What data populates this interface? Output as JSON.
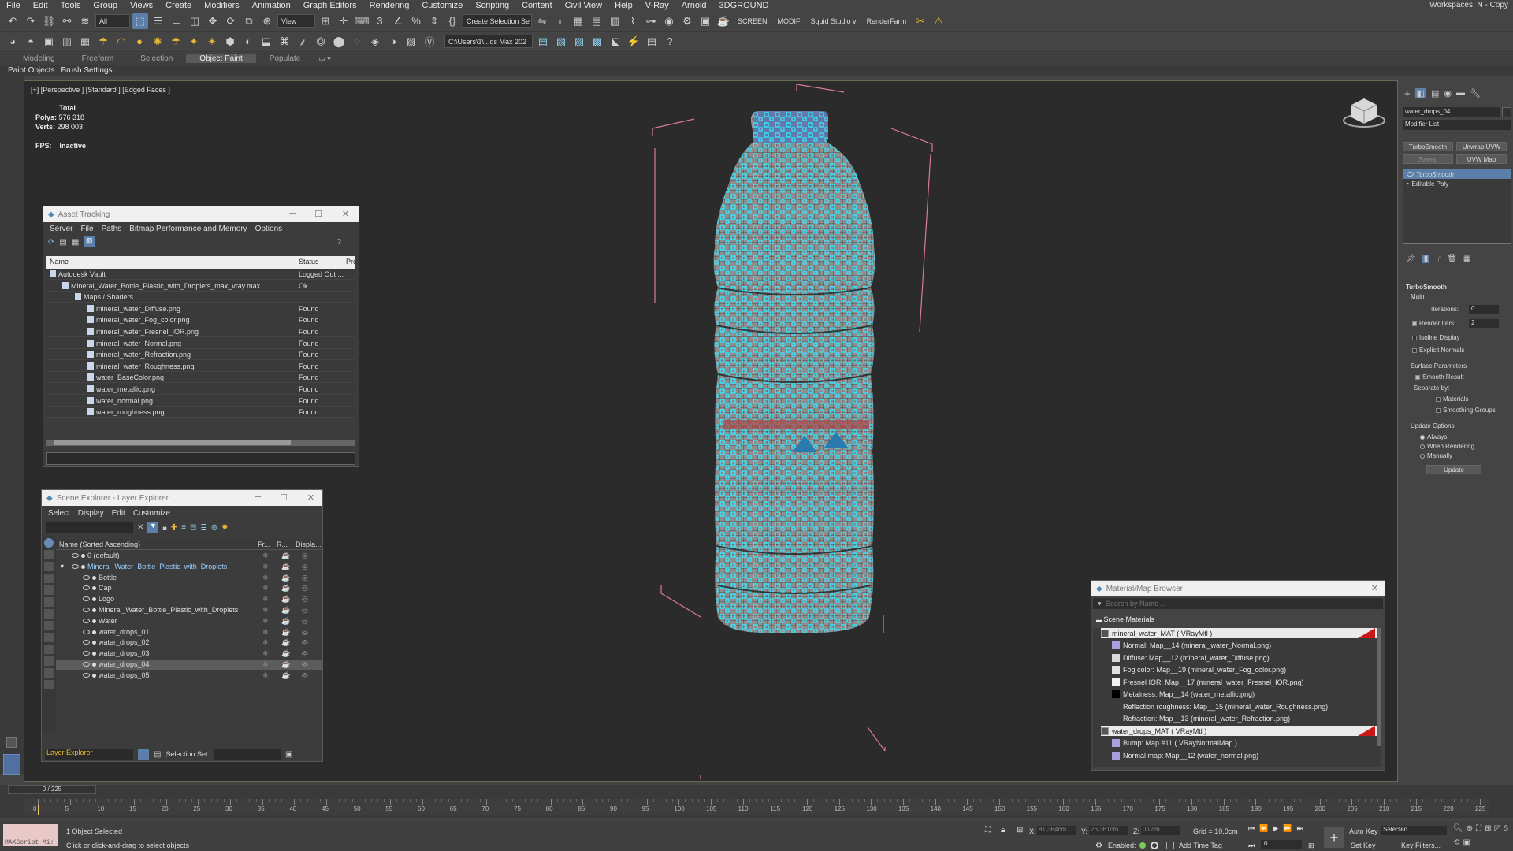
{
  "menubar": {
    "items": [
      "File",
      "Edit",
      "Tools",
      "Group",
      "Views",
      "Create",
      "Modifiers",
      "Animation",
      "Graph Editors",
      "Rendering",
      "Customize",
      "Scripting",
      "Content",
      "Civil View",
      "Help",
      "V-Ray",
      "Arnold",
      "3DGROUND"
    ],
    "workspace": "Workspaces:  N - Copy"
  },
  "toolbar1": {
    "selection_filter": "All",
    "ref_coord": "View",
    "named_selection": "Create Selection Se",
    "screen_label": "SCREEN",
    "modif_label": "MODIF",
    "studio_label": "Squid Studio v",
    "renderfarm_label": "RenderFarm"
  },
  "toolbar2": {
    "project_path": "C:\\Users\\1\\...ds Max 202"
  },
  "ribbon": {
    "tabs": [
      "Modeling",
      "Freeform",
      "Selection",
      "Object Paint",
      "Populate"
    ],
    "active": "Object Paint",
    "sub_items": [
      "Paint Objects",
      "Brush Settings"
    ]
  },
  "viewport": {
    "label": "[+] [Perspective ] [Standard ] [Edged Faces ]",
    "stats": {
      "total_label": "Total",
      "polys_label": "Polys:",
      "polys_value": "576 318",
      "verts_label": "Verts:",
      "verts_value": "298 003",
      "fps_label": "FPS:",
      "fps_value": "Inactive"
    }
  },
  "asset_tracking": {
    "title": "Asset Tracking",
    "menus": [
      "Server",
      "File",
      "Paths",
      "Bitmap Performance and Memory",
      "Options"
    ],
    "columns": [
      "Name",
      "Status",
      "Pro"
    ],
    "rows": [
      {
        "name": "Autodesk Vault",
        "status": "Logged Out ..."
      },
      {
        "name": "Mineral_Water_Bottle_Plastic_with_Droplets_max_vray.max",
        "status": "Ok"
      },
      {
        "name": "Maps / Shaders",
        "status": ""
      },
      {
        "name": "mineral_water_Diffuse.png",
        "status": "Found"
      },
      {
        "name": "mineral_water_Fog_color.png",
        "status": "Found"
      },
      {
        "name": "mineral_water_Fresnel_IOR.png",
        "status": "Found"
      },
      {
        "name": "mineral_water_Normal.png",
        "status": "Found"
      },
      {
        "name": "mineral_water_Refraction.png",
        "status": "Found"
      },
      {
        "name": "mineral_water_Roughness.png",
        "status": "Found"
      },
      {
        "name": "water_BaseColor.png",
        "status": "Found"
      },
      {
        "name": "water_metallic.png",
        "status": "Found"
      },
      {
        "name": "water_normal.png",
        "status": "Found"
      },
      {
        "name": "water_roughness.png",
        "status": "Found"
      }
    ]
  },
  "scene_explorer": {
    "title": "Scene Explorer - Layer Explorer",
    "menus": [
      "Select",
      "Display",
      "Edit",
      "Customize"
    ],
    "columns": [
      "Name (Sorted Ascending)",
      "Fr...",
      "R...",
      "Displa..."
    ],
    "rows": [
      {
        "name": "0 (default)",
        "selected": false
      },
      {
        "name": "Mineral_Water_Bottle_Plastic_with_Droplets",
        "selected": false
      },
      {
        "name": "Bottle",
        "selected": false
      },
      {
        "name": "Cap",
        "selected": false
      },
      {
        "name": "Logo",
        "selected": false
      },
      {
        "name": "Mineral_Water_Bottle_Plastic_with_Droplets",
        "selected": false
      },
      {
        "name": "Water",
        "selected": false
      },
      {
        "name": "water_drops_01",
        "selected": false
      },
      {
        "name": "water_drops_02",
        "selected": false
      },
      {
        "name": "water_drops_03",
        "selected": false
      },
      {
        "name": "water_drops_04",
        "selected": true
      },
      {
        "name": "water_drops_05",
        "selected": false
      }
    ],
    "footer_layer": "Layer Explorer",
    "selection_set_label": "Selection Set:"
  },
  "material_browser": {
    "title": "Material/Map Browser",
    "search_placeholder": "Search by Name ...",
    "section": "Scene Materials",
    "rows": [
      {
        "text": "mineral_water_MAT  ( VRayMtl )",
        "header": true,
        "swatch": "#555555"
      },
      {
        "text": "Normal: Map__14 (mineral_water_Normal.png)",
        "header": false,
        "swatch": "#a89ee0"
      },
      {
        "text": "Diffuse: Map__12 (mineral_water_Diffuse.png)",
        "header": false,
        "swatch": "#d8d8d8"
      },
      {
        "text": "Fog color: Map__19 (mineral_water_Fog_color.png)",
        "header": false,
        "swatch": "#e0e0e0"
      },
      {
        "text": "Fresnel IOR: Map__17 (mineral_water_Fresnel_IOR.png)",
        "header": false,
        "swatch": "#f2f2f2"
      },
      {
        "text": "Metalness: Map__14 (water_metallic.png)",
        "header": false,
        "swatch": "#000000"
      },
      {
        "text": "Reflection roughness: Map__15 (mineral_water_Roughness.png)",
        "header": false,
        "swatch": "#3a3a3a"
      },
      {
        "text": "Refraction: Map__13 (mineral_water_Refraction.png)",
        "header": false,
        "swatch": "#3a3a3a"
      },
      {
        "text": "water_drops_MAT  ( VRayMtl )",
        "header": true,
        "swatch": "#555555"
      },
      {
        "text": "Bump: Map #11  ( VRayNormalMap )",
        "header": false,
        "swatch": "#a89ee0"
      },
      {
        "text": "Normal map: Map__12 (water_normal.png)",
        "header": false,
        "swatch": "#a89ee0"
      }
    ]
  },
  "command_panel": {
    "object_name": "water_drops_04",
    "modifier_list": "Modifier List",
    "buttons": [
      "TurboSmooth",
      "Unwrap UVW",
      "Sweep",
      "UVW Map"
    ],
    "stack": [
      "TurboSmooth",
      "Editable Poly"
    ],
    "rollout_title": "TurboSmooth",
    "main_label": "Main",
    "iterations_label": "Iterations:",
    "iterations_value": "0",
    "render_iters_label": "Render Iters:",
    "render_iters_value": "2",
    "isoline_label": "Isoline Display",
    "explicit_normals_label": "Explicit Normals",
    "surface_label": "Surface Parameters",
    "smooth_result_label": "Smooth Result",
    "separate_label": "Separate by:",
    "materials_label": "Materials",
    "smoothing_groups_label": "Smoothing Groups",
    "update_options_label": "Update Options",
    "always_label": "Always",
    "when_rendering_label": "When Rendering",
    "manually_label": "Manually",
    "update_button": "Update"
  },
  "timeline": {
    "frame_counter": "0 / 225",
    "ticks": [
      "0",
      "5",
      "10",
      "15",
      "20",
      "25",
      "30",
      "35",
      "40",
      "45",
      "50",
      "55",
      "60",
      "65",
      "70",
      "75",
      "80",
      "85",
      "90",
      "95",
      "100",
      "105",
      "110",
      "115",
      "120",
      "125",
      "130",
      "135",
      "140",
      "145",
      "150",
      "155",
      "160",
      "165",
      "170",
      "175",
      "180",
      "185",
      "190",
      "195",
      "200",
      "205",
      "210",
      "215",
      "220",
      "225"
    ]
  },
  "statusbar": {
    "script_label": "MAXScript Mi:",
    "selected_count": "1 Object Selected",
    "prompt": "Click or click-and-drag to select objects",
    "x_label": "X:",
    "x_value": "81,364cm",
    "y_label": "Y:",
    "y_value": "26,361cm",
    "z_label": "Z:",
    "z_value": "0,0cm",
    "grid": "Grid = 10,0cm",
    "enabled_label": "Enabled:",
    "add_time_tag": "Add Time Tag",
    "auto_key": "Auto Key",
    "selected_dropdown": "Selected",
    "set_key": "Set Key",
    "key_filters": "Key Filters...",
    "frame_field": "0"
  }
}
